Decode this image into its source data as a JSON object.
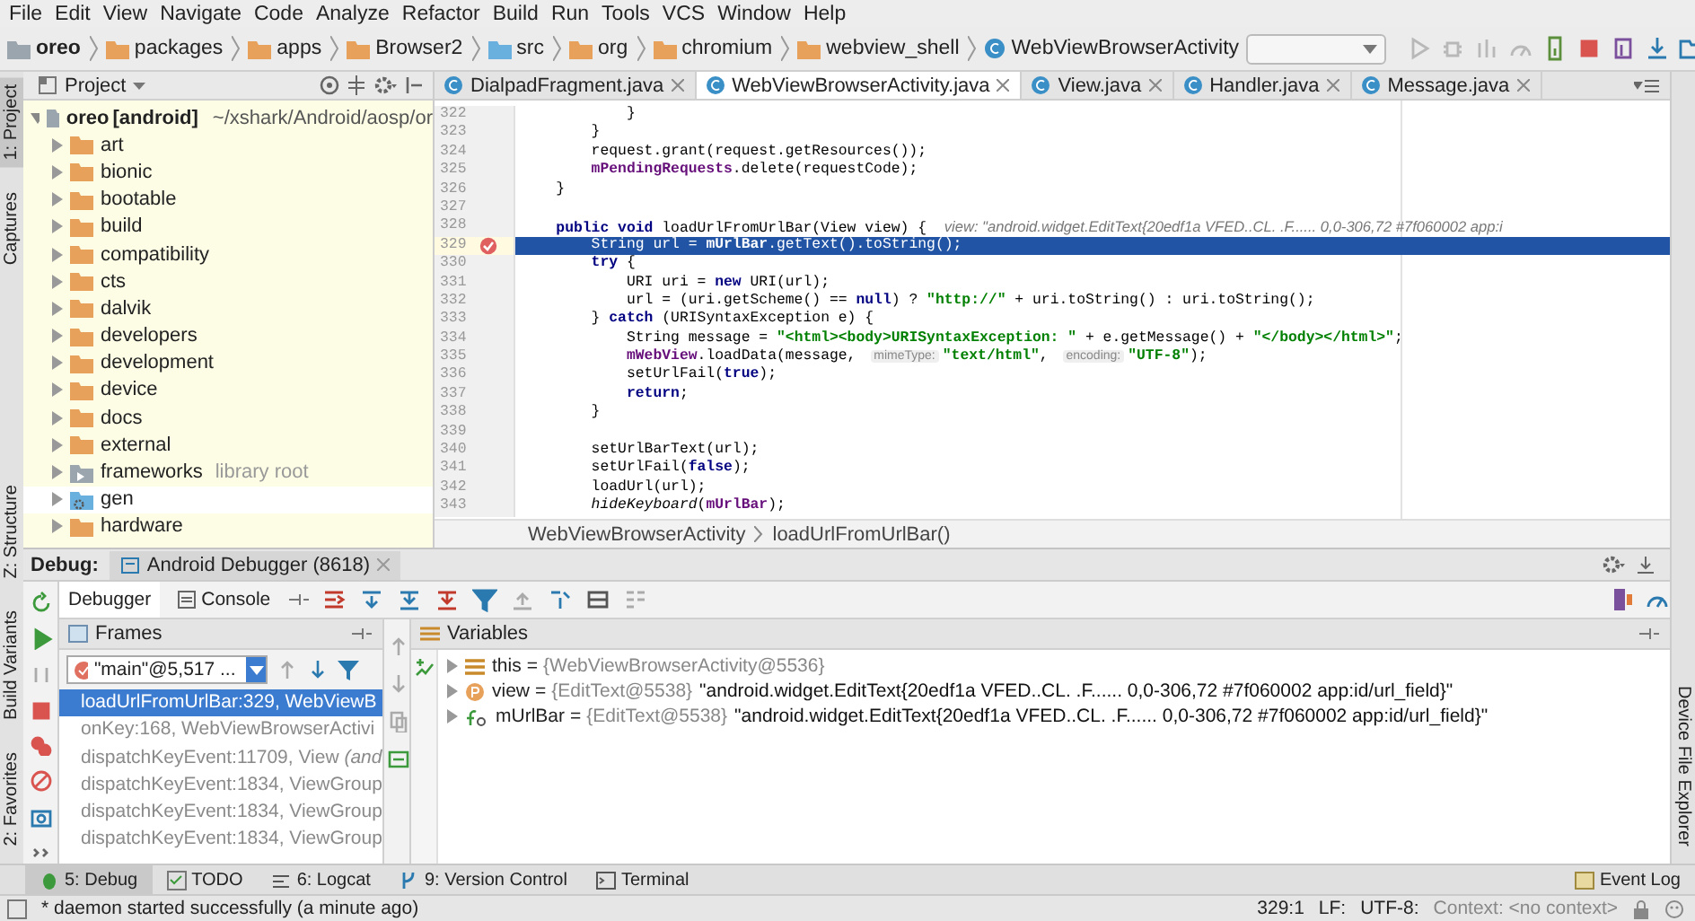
{
  "menu": [
    "File",
    "Edit",
    "View",
    "Navigate",
    "Code",
    "Analyze",
    "Refactor",
    "Build",
    "Run",
    "Tools",
    "VCS",
    "Window",
    "Help"
  ],
  "breadcrumbs": [
    {
      "label": "oreo",
      "kind": "module"
    },
    {
      "label": "packages",
      "kind": "folder"
    },
    {
      "label": "apps",
      "kind": "folder"
    },
    {
      "label": "Browser2",
      "kind": "folder"
    },
    {
      "label": "src",
      "kind": "source"
    },
    {
      "label": "org",
      "kind": "folder"
    },
    {
      "label": "chromium",
      "kind": "folder"
    },
    {
      "label": "webview_shell",
      "kind": "folder"
    },
    {
      "label": "WebViewBrowserActivity",
      "kind": "class"
    }
  ],
  "left_strip": [
    {
      "label": "1: Project",
      "selected": true
    },
    {
      "label": "Captures",
      "selected": false
    },
    {
      "label": "Z: Structure",
      "selected": false
    },
    {
      "label": "Build Variants",
      "selected": false
    },
    {
      "label": "2: Favorites",
      "selected": false
    }
  ],
  "right_strip": [
    {
      "label": "Device File Explorer",
      "selected": false
    }
  ],
  "project": {
    "title": "Project",
    "tree": [
      {
        "label": "oreo",
        "badge": "[android]",
        "path": "~/xshark/Android/aosp/or",
        "kind": "module",
        "expanded": true,
        "children": [
          {
            "label": "art",
            "kind": "folder"
          },
          {
            "label": "bionic",
            "kind": "folder"
          },
          {
            "label": "bootable",
            "kind": "folder"
          },
          {
            "label": "build",
            "kind": "folder"
          },
          {
            "label": "compatibility",
            "kind": "folder"
          },
          {
            "label": "cts",
            "kind": "folder"
          },
          {
            "label": "dalvik",
            "kind": "folder"
          },
          {
            "label": "developers",
            "kind": "folder"
          },
          {
            "label": "development",
            "kind": "folder"
          },
          {
            "label": "device",
            "kind": "folder"
          },
          {
            "label": "docs",
            "kind": "folder"
          },
          {
            "label": "external",
            "kind": "folder"
          },
          {
            "label": "frameworks",
            "note": "library root",
            "kind": "library"
          },
          {
            "label": "gen",
            "kind": "generated"
          },
          {
            "label": "hardware",
            "kind": "folder"
          }
        ]
      }
    ]
  },
  "editor": {
    "tabs": [
      {
        "label": "DialpadFragment.java",
        "selected": false
      },
      {
        "label": "WebViewBrowserActivity.java",
        "selected": true
      },
      {
        "label": "View.java",
        "selected": false
      },
      {
        "label": "Handler.java",
        "selected": false
      },
      {
        "label": "Message.java",
        "selected": false
      }
    ],
    "lines": [
      {
        "number": "322",
        "breakpoint": false,
        "selected": false,
        "tokens": [
          {
            "text": "            }",
            "kind": "plain"
          }
        ]
      },
      {
        "number": "323",
        "breakpoint": false,
        "selected": false,
        "tokens": [
          {
            "text": "        }",
            "kind": "plain"
          }
        ]
      },
      {
        "number": "324",
        "breakpoint": false,
        "selected": false,
        "tokens": [
          {
            "text": "        request.grant(request.getResources());",
            "kind": "plain"
          }
        ]
      },
      {
        "number": "325",
        "breakpoint": false,
        "selected": false,
        "tokens": [
          {
            "text": "        mPendingRequests",
            "kind": "field"
          },
          {
            "text": ".delete(requestCode);",
            "kind": "plain"
          }
        ]
      },
      {
        "number": "326",
        "breakpoint": false,
        "selected": false,
        "tokens": [
          {
            "text": "    }",
            "kind": "plain"
          }
        ]
      },
      {
        "number": "327",
        "breakpoint": false,
        "selected": false
      },
      {
        "number": "328",
        "breakpoint": false,
        "selected": false,
        "tokens": [
          {
            "text": "    public void",
            "kind": "keyword"
          },
          {
            "text": " loadUrlFromUrlBar(View view) {  ",
            "kind": "plain"
          },
          {
            "text": "view: \"android.widget.EditText{20edf1a VFED..CL. .F...... 0,0-306,72 #7f060002 app:i",
            "kind": "inline_value"
          }
        ]
      },
      {
        "number": "329",
        "breakpoint": true,
        "selected": true,
        "tokens": [
          {
            "text": "        String url = ",
            "kind": "plain"
          },
          {
            "text": "mUrlBar",
            "kind": "field"
          },
          {
            "text": ".getText().toString();",
            "kind": "plain"
          }
        ]
      },
      {
        "number": "330",
        "breakpoint": false,
        "selected": false,
        "tokens": [
          {
            "text": "        try",
            "kind": "keyword"
          },
          {
            "text": " {",
            "kind": "plain"
          }
        ]
      },
      {
        "number": "331",
        "breakpoint": false,
        "selected": false,
        "tokens": [
          {
            "text": "            URI uri = ",
            "kind": "plain"
          },
          {
            "text": "new",
            "kind": "keyword"
          },
          {
            "text": " URI(url);",
            "kind": "plain"
          }
        ]
      },
      {
        "number": "332",
        "breakpoint": false,
        "selected": false,
        "tokens": [
          {
            "text": "            url = (uri.getScheme() == ",
            "kind": "plain"
          },
          {
            "text": "null",
            "kind": "keyword"
          },
          {
            "text": ") ? ",
            "kind": "plain"
          },
          {
            "text": "\"http://\"",
            "kind": "string"
          },
          {
            "text": " + uri.toString() : uri.toString();",
            "kind": "plain"
          }
        ]
      },
      {
        "number": "333",
        "breakpoint": false,
        "selected": false,
        "tokens": [
          {
            "text": "        } ",
            "kind": "plain"
          },
          {
            "text": "catch",
            "kind": "keyword"
          },
          {
            "text": " (URISyntaxException e) {",
            "kind": "plain"
          }
        ]
      },
      {
        "number": "334",
        "breakpoint": false,
        "selected": false,
        "tokens": [
          {
            "text": "            String message = ",
            "kind": "plain"
          },
          {
            "text": "\"<html><body>URISyntaxException: \"",
            "kind": "string"
          },
          {
            "text": " + e.getMessage() + ",
            "kind": "plain"
          },
          {
            "text": "\"</body></html>\"",
            "kind": "string"
          },
          {
            "text": ";",
            "kind": "plain"
          }
        ]
      },
      {
        "number": "335",
        "breakpoint": false,
        "selected": false,
        "tokens": [
          {
            "text": "            mWebView",
            "kind": "field"
          },
          {
            "text": ".loadData(message, ",
            "kind": "plain"
          },
          {
            "text": "mimeType:",
            "kind": "hint"
          },
          {
            "text": "\"text/html\"",
            "kind": "string"
          },
          {
            "text": ", ",
            "kind": "plain"
          },
          {
            "text": "encoding:",
            "kind": "hint"
          },
          {
            "text": "\"UTF-8\"",
            "kind": "string"
          },
          {
            "text": ");",
            "kind": "plain"
          }
        ]
      },
      {
        "number": "336",
        "breakpoint": false,
        "selected": false,
        "tokens": [
          {
            "text": "            setUrlFail(",
            "kind": "plain"
          },
          {
            "text": "true",
            "kind": "keyword"
          },
          {
            "text": ");",
            "kind": "plain"
          }
        ]
      },
      {
        "number": "337",
        "breakpoint": false,
        "selected": false,
        "tokens": [
          {
            "text": "            return",
            "kind": "keyword"
          },
          {
            "text": ";",
            "kind": "plain"
          }
        ]
      },
      {
        "number": "338",
        "breakpoint": false,
        "selected": false,
        "tokens": [
          {
            "text": "        }",
            "kind": "plain"
          }
        ]
      },
      {
        "number": "339",
        "breakpoint": false,
        "selected": false
      },
      {
        "number": "340",
        "breakpoint": false,
        "selected": false,
        "tokens": [
          {
            "text": "        setUrlBarText(url);",
            "kind": "plain"
          }
        ]
      },
      {
        "number": "341",
        "breakpoint": false,
        "selected": false,
        "tokens": [
          {
            "text": "        setUrlFail(",
            "kind": "plain"
          },
          {
            "text": "false",
            "kind": "keyword"
          },
          {
            "text": ");",
            "kind": "plain"
          }
        ]
      },
      {
        "number": "342",
        "breakpoint": false,
        "selected": false,
        "tokens": [
          {
            "text": "        loadUrl(url);",
            "kind": "plain"
          }
        ]
      },
      {
        "number": "343",
        "breakpoint": false,
        "selected": false,
        "tokens": [
          {
            "text": "        hideKeyboard",
            "kind": "static"
          },
          {
            "text": "(",
            "kind": "plain"
          },
          {
            "text": "mUrlBar",
            "kind": "field"
          },
          {
            "text": ");",
            "kind": "plain"
          }
        ]
      }
    ],
    "path": [
      "WebViewBrowserActivity",
      "loadUrlFromUrlBar()"
    ]
  },
  "debug": {
    "title": "Debug:",
    "session": "Android Debugger (8618)",
    "tabs": [
      {
        "label": "Debugger",
        "selected": true
      },
      {
        "label": "Console",
        "selected": false
      }
    ],
    "frames": {
      "title": "Frames",
      "thread": "\"main\"@5,517 ...",
      "items": [
        {
          "label": "loadUrlFromUrlBar:329, WebViewB",
          "selected": true
        },
        {
          "label": "onKey:168, WebViewBrowserActivi",
          "selected": false
        },
        {
          "label": "dispatchKeyEvent:11709, View *(and*",
          "selected": false
        },
        {
          "label": "dispatchKeyEvent:1834, ViewGroup",
          "selected": false
        },
        {
          "label": "dispatchKeyEvent:1834, ViewGroup",
          "selected": false
        },
        {
          "label": "dispatchKeyEvent:1834, ViewGroup",
          "selected": false
        }
      ]
    },
    "variables": {
      "title": "Variables",
      "items": [
        {
          "kind": "this",
          "name": "this",
          "sign": "=",
          "ref": "{WebViewBrowserActivity@5536}"
        },
        {
          "kind": "parameter",
          "name": "view",
          "sign": "=",
          "ref": "{EditText@5538}",
          "value": "\"android.widget.EditText{20edf1a VFED..CL. .F...... 0,0-306,72 #7f060002 app:id/url_field}\""
        },
        {
          "kind": "field",
          "name": "mUrlBar",
          "sign": "=",
          "ref": "{EditText@5538}",
          "value": "\"android.widget.EditText{20edf1a VFED..CL. .F...... 0,0-306,72 #7f060002 app:id/url_field}\""
        }
      ]
    }
  },
  "tool_tabs": [
    {
      "label": "5: Debug",
      "kind": "debug",
      "selected": true
    },
    {
      "label": "TODO",
      "kind": "todo",
      "selected": false
    },
    {
      "label": "6: Logcat",
      "kind": "logcat",
      "selected": false
    },
    {
      "label": "9: Version Control",
      "kind": "vcs",
      "selected": false
    },
    {
      "label": "Terminal",
      "kind": "terminal",
      "selected": false
    }
  ],
  "event_log": "Event Log",
  "status": {
    "message": "* daemon started successfully (a minute ago)",
    "position": "329:1",
    "line_separator": "LF:",
    "encoding": "UTF-8:",
    "context": "Context: <no context>"
  }
}
